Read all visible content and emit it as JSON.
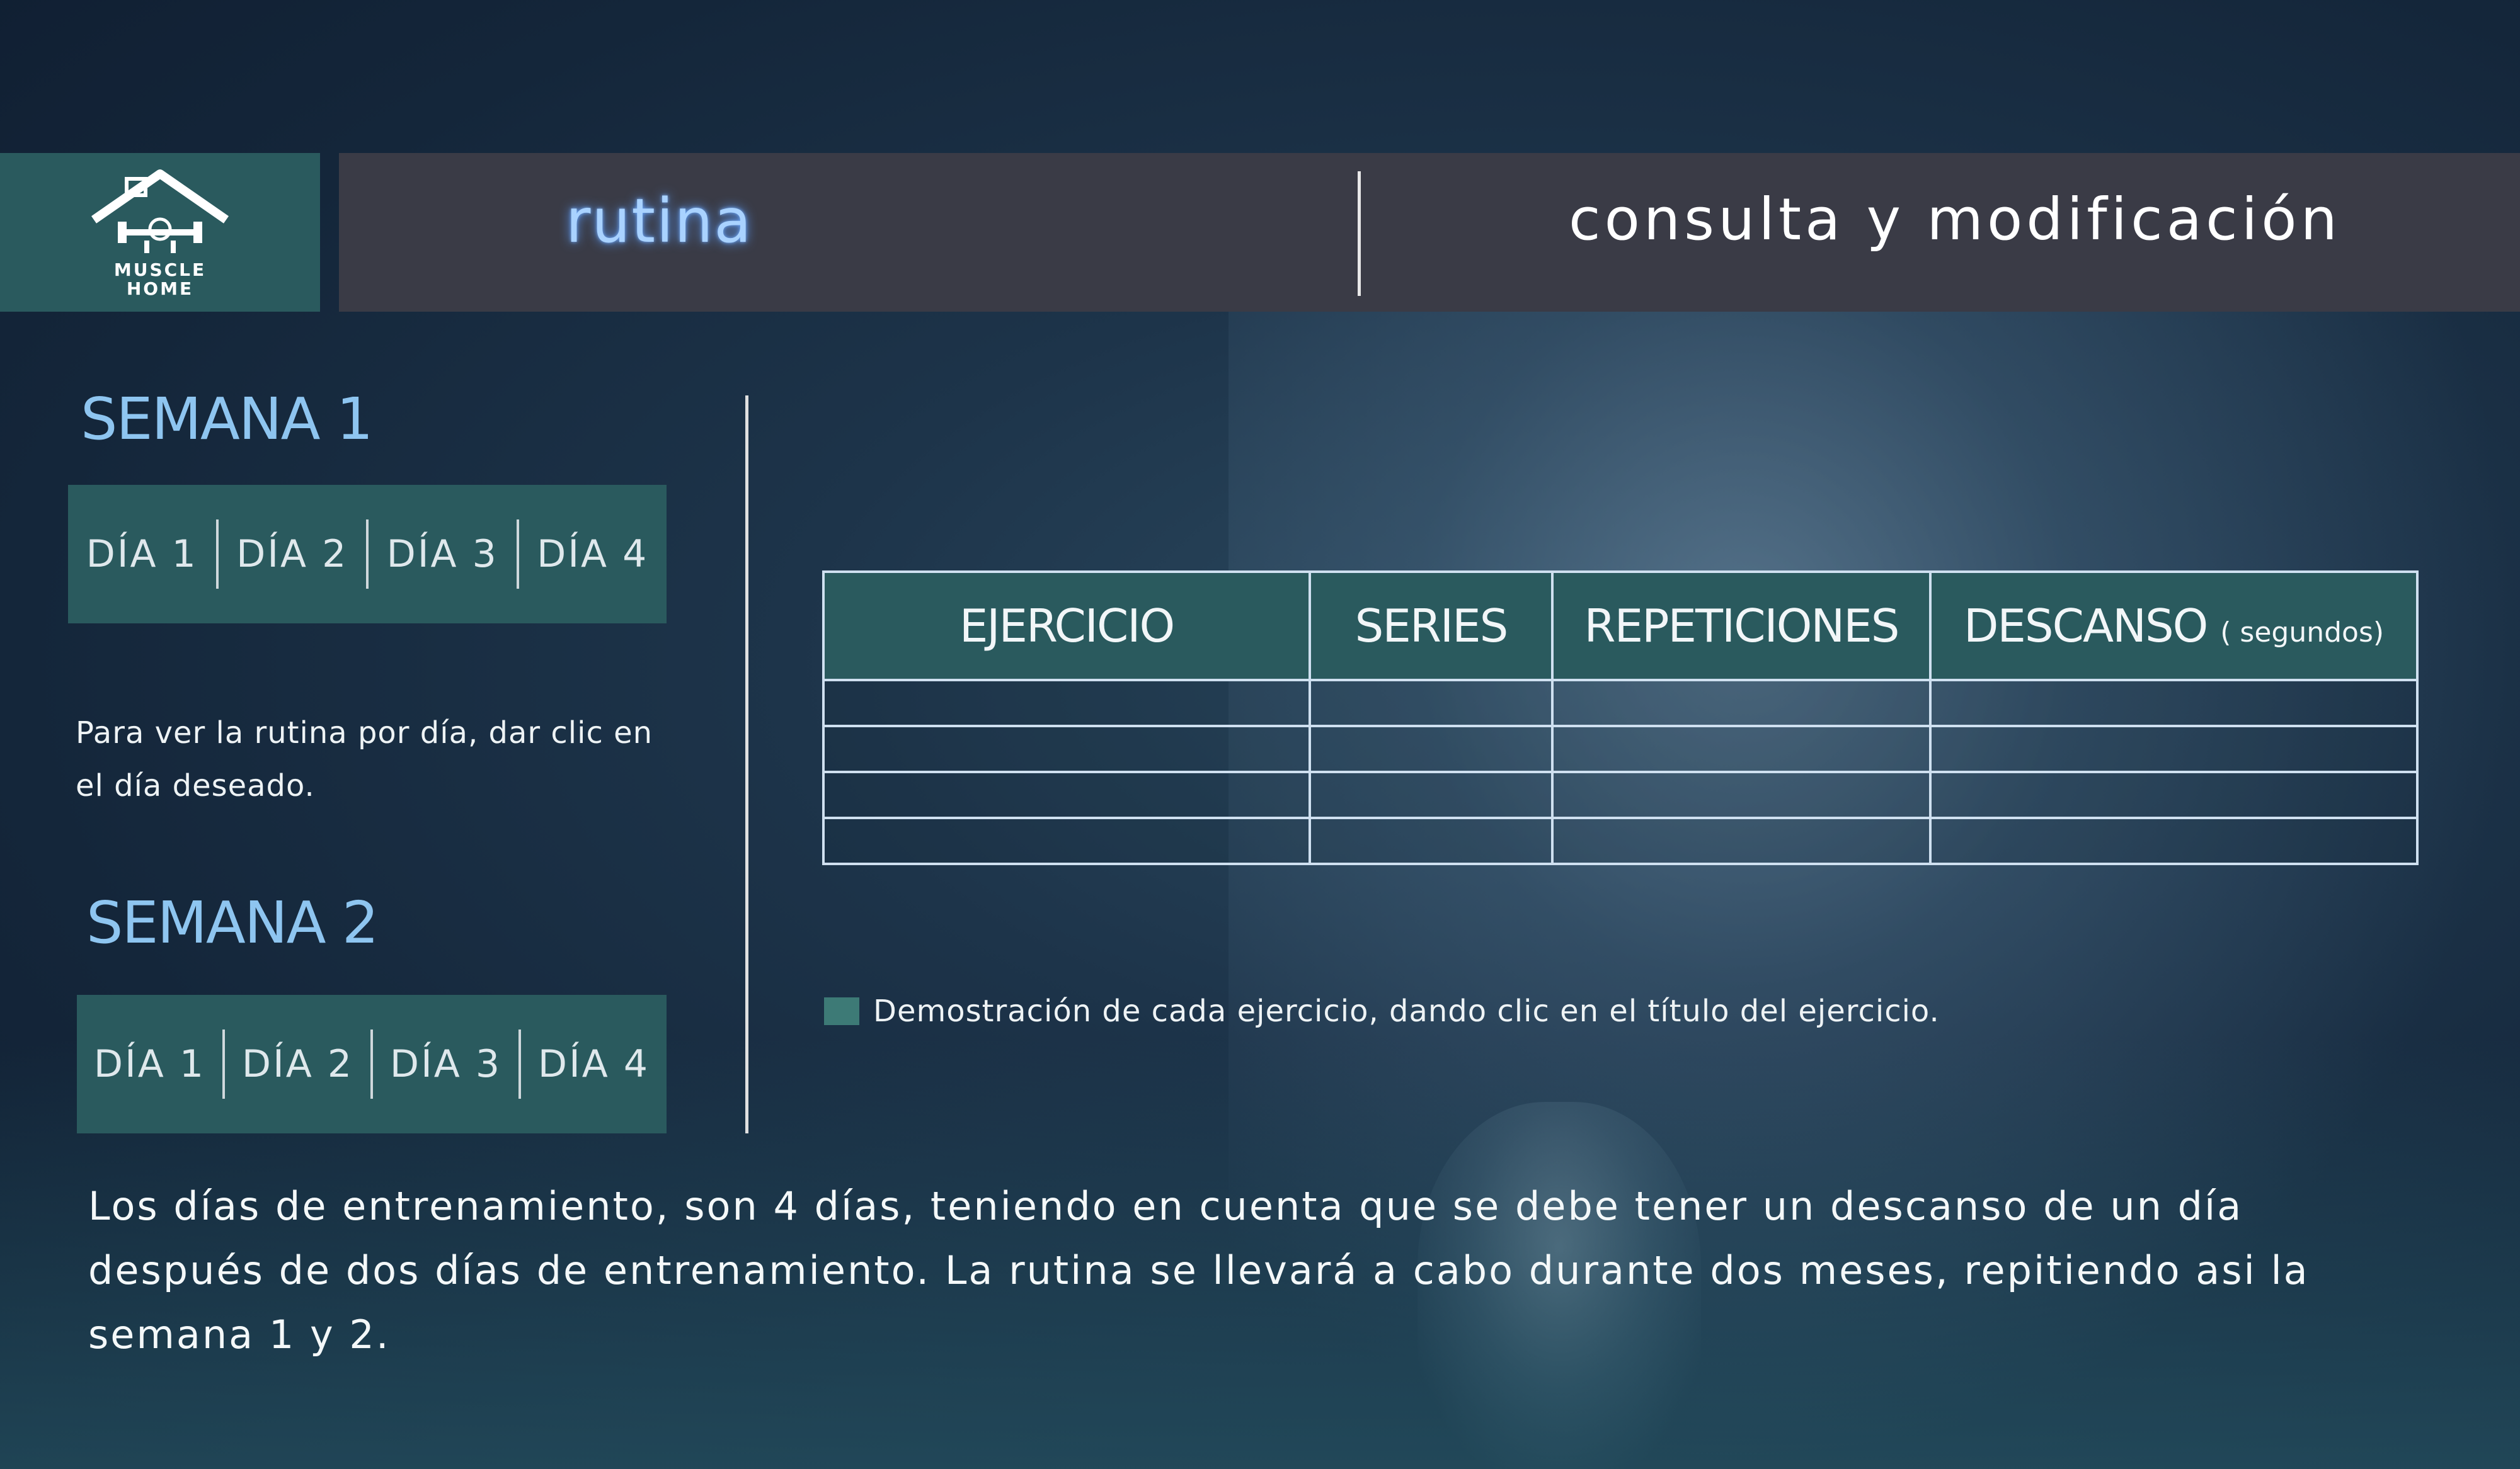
{
  "logo": {
    "line1": "MUSCLE",
    "line2": "HOME"
  },
  "header": {
    "title": "rutina",
    "subtitle": "consulta y modificación"
  },
  "week1": {
    "title": "SEMANA 1",
    "days": [
      "DÍA 1",
      "DÍA 2",
      "DÍA 3",
      "DÍA 4"
    ]
  },
  "week2": {
    "title": "SEMANA 2",
    "days": [
      "DÍA 1",
      "DÍA 2",
      "DÍA 3",
      "DÍA 4"
    ]
  },
  "hint": "Para ver la rutina por día, dar clic en el día deseado.",
  "table": {
    "headers": [
      "EJERCICIO",
      "SERIES",
      "REPETICIONES",
      "DESCANSO"
    ],
    "descanso_unit": "( segundos)"
  },
  "legend": "Demostración de cada ejercicio, dando clic en el título del ejercicio.",
  "note": "Los días de entrenamiento, son 4 días, teniendo en cuenta que se debe tener un descanso de un día después de dos días de entrenamiento. La rutina se llevará a cabo durante dos meses, repitiendo asi la semana 1 y 2.",
  "colors": {
    "accent": "#2a5a5e",
    "title_glow": "#a9d2ff",
    "header_bg": "#3a3b46"
  }
}
